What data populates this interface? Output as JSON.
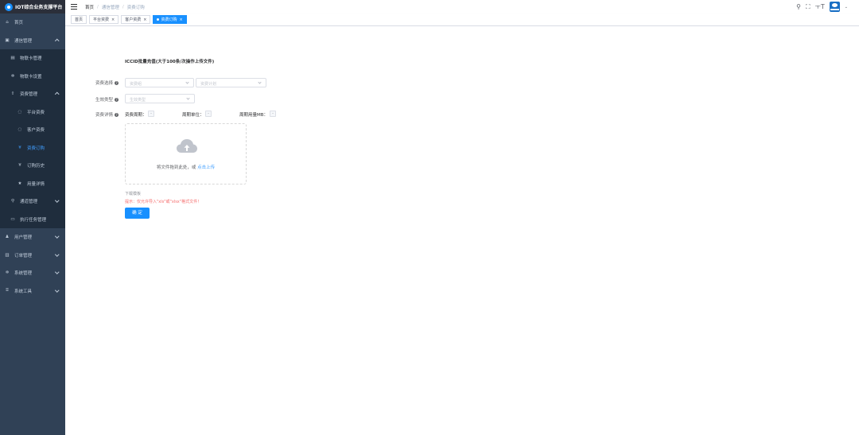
{
  "app": {
    "title": "IOT综合业务支撑平台"
  },
  "sidebar": {
    "items": [
      {
        "label": "首页",
        "icon": "home-icon",
        "glyph": "⌂"
      },
      {
        "label": "通信管理",
        "icon": "card-icon",
        "glyph": "▣"
      },
      {
        "label": "物联卡管理",
        "icon": "list-icon",
        "glyph": "▤"
      },
      {
        "label": "物联卡设置",
        "icon": "gear-icon",
        "glyph": "✲"
      },
      {
        "label": "资费管理",
        "icon": "fee-icon",
        "glyph": "⇧"
      },
      {
        "label": "平台资费",
        "icon": "shield-icon",
        "glyph": "◌"
      },
      {
        "label": "客户资费",
        "icon": "shield-icon",
        "glyph": "◌"
      },
      {
        "label": "资费订购",
        "icon": "cart-icon",
        "glyph": "¥"
      },
      {
        "label": "订购历史",
        "icon": "yen-icon",
        "glyph": "¥"
      },
      {
        "label": "用量详情",
        "icon": "star-icon",
        "glyph": "★"
      },
      {
        "label": "通道管理",
        "icon": "tree-icon",
        "glyph": "⚲"
      },
      {
        "label": "执行任务管理",
        "icon": "monitor-icon",
        "glyph": "▭"
      },
      {
        "label": "用户管理",
        "icon": "user-icon",
        "glyph": "♟"
      },
      {
        "label": "订单管理",
        "icon": "chart-icon",
        "glyph": "▥"
      },
      {
        "label": "系统管理",
        "icon": "settings-icon",
        "glyph": "✲"
      },
      {
        "label": "系统工具",
        "icon": "tool-icon",
        "glyph": "⌸"
      }
    ]
  },
  "breadcrumb": [
    "首页",
    "通信管理",
    "资费订购"
  ],
  "tags": [
    {
      "label": "首页"
    },
    {
      "label": "平台资费"
    },
    {
      "label": "客户资费"
    },
    {
      "label": "资费订购"
    }
  ],
  "form": {
    "title": "ICCID批量充值(大于100条/次操作上传文件)",
    "fee_select_label": "资费选择",
    "fee_group_placeholder": "资费组",
    "fee_plan_placeholder": "资费计划",
    "effect_type_label": "生效类型",
    "effect_type_placeholder": "生效类型",
    "fee_detail_label": "资费详情",
    "fee_cycle_label": "资费周期：",
    "fee_cycle_value": "-",
    "cycle_unit_label": "周期单位：",
    "cycle_unit_value": "-",
    "cycle_usage_label": "周期用量MB：",
    "cycle_usage_value": "-",
    "help_glyph": "?"
  },
  "upload": {
    "text": "将文件拖到此处，或",
    "link": "点击上传"
  },
  "download_template": "下载模板",
  "tip": "提示：仅允许导入\"xls\"或\"xlsx\"格式文件！",
  "confirm_button": "确 定",
  "navbar_icons": {
    "search": "⚲",
    "fullscreen": "⛶",
    "font_size": "ㅜT",
    "caret": "⌄"
  },
  "colors": {
    "sidebar_bg": "#304156",
    "accent": "#1890ff",
    "active_text": "#409eff",
    "danger": "#f56c6c"
  }
}
